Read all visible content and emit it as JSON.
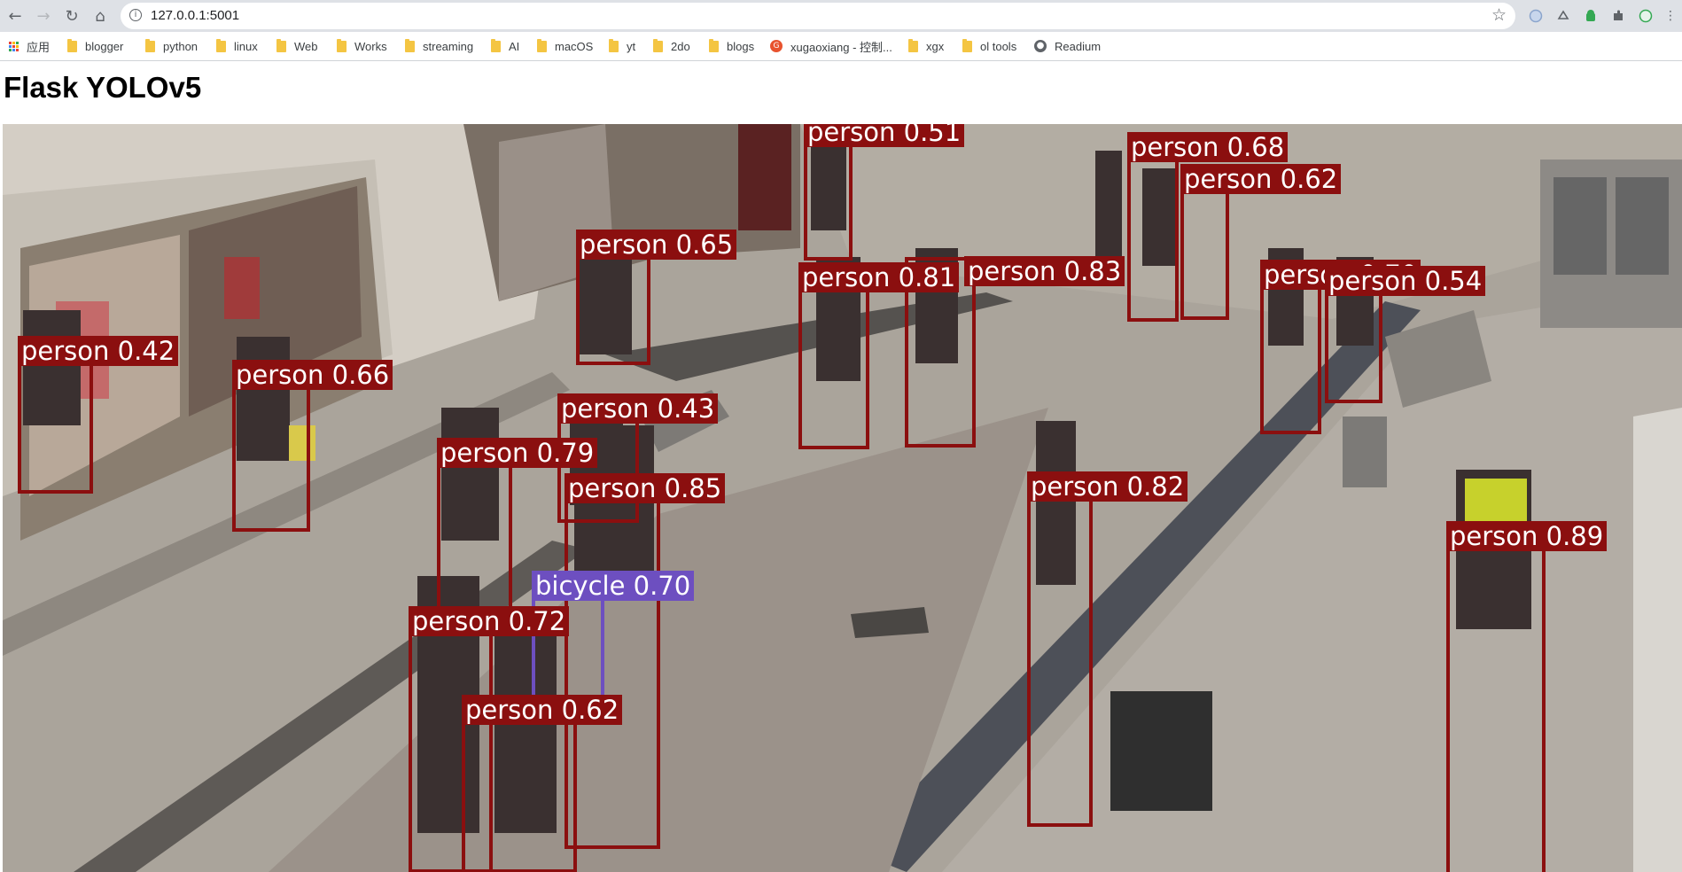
{
  "browser": {
    "url": "127.0.0.1:5001",
    "bookmarks": [
      {
        "label": "应用",
        "icon": "apps-grid-icon"
      },
      {
        "label": "blogger",
        "icon": "folder-icon"
      },
      {
        "label": "python",
        "icon": "folder-icon"
      },
      {
        "label": "linux",
        "icon": "folder-icon"
      },
      {
        "label": "Web",
        "icon": "folder-icon"
      },
      {
        "label": "Works",
        "icon": "folder-icon"
      },
      {
        "label": "streaming",
        "icon": "folder-icon"
      },
      {
        "label": "AI",
        "icon": "folder-icon"
      },
      {
        "label": "macOS",
        "icon": "folder-icon"
      },
      {
        "label": "yt",
        "icon": "folder-icon"
      },
      {
        "label": "2do",
        "icon": "folder-icon"
      },
      {
        "label": "blogs",
        "icon": "folder-icon"
      },
      {
        "label": "xugaoxiang - 控制...",
        "icon": "site-favicon-icon"
      },
      {
        "label": "xgx",
        "icon": "folder-icon"
      },
      {
        "label": "ol tools",
        "icon": "folder-icon"
      },
      {
        "label": "Readium",
        "icon": "globe-icon"
      }
    ]
  },
  "page": {
    "title": "Flask YOLOv5"
  },
  "detections": [
    {
      "label": "person 0.51"
    },
    {
      "label": "person 0.68"
    },
    {
      "label": "person 0.62"
    },
    {
      "label": "person 0.65"
    },
    {
      "label": "person 0.83"
    },
    {
      "label": "person 0.81"
    },
    {
      "label": "person 0.70"
    },
    {
      "label": "person 0.54"
    },
    {
      "label": "person 0.42"
    },
    {
      "label": "person 0.66"
    },
    {
      "label": "person 0.43"
    },
    {
      "label": "person 0.79"
    },
    {
      "label": "person 0.85"
    },
    {
      "label": "person 0.82"
    },
    {
      "label": "person 0.89"
    },
    {
      "label": "bicycle 0.70"
    },
    {
      "label": "person 0.72"
    },
    {
      "label": "person 0.62"
    }
  ]
}
